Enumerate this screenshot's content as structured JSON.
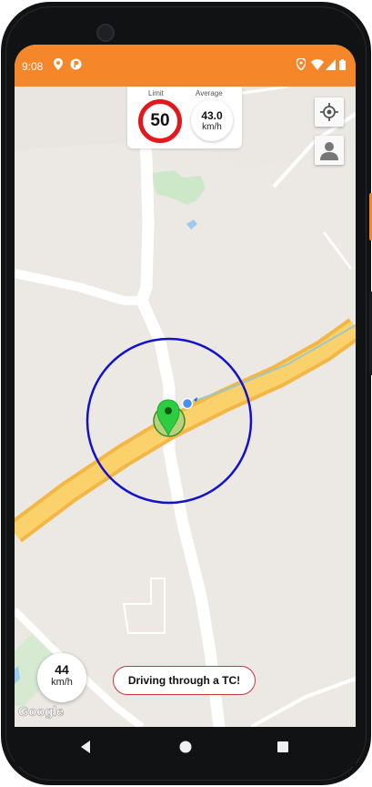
{
  "status_bar": {
    "time": "9:08",
    "background_color": "#f5862a",
    "left_icons": [
      "location-pin-icon",
      "app-p-icon"
    ],
    "right_icons": [
      "location-icon",
      "wifi-icon",
      "signal-icon",
      "battery-icon"
    ]
  },
  "speed_card": {
    "limit_label": "Limit",
    "limit_value": "50",
    "average_label": "Average",
    "average_value": "43.0",
    "average_unit": "km/h",
    "limit_ring_color": "#e3171c"
  },
  "map_controls": {
    "my_location_icon": "crosshair-icon",
    "profile_icon": "person-icon"
  },
  "current_speed": {
    "value": "44",
    "unit": "km/h"
  },
  "alert": {
    "message": "Driving through a TC!",
    "border_color": "#c8363c"
  },
  "map": {
    "attribution": "Google",
    "radius_circle_color": "#1212c8",
    "marker_color": "#2ecc40",
    "road_color": "#f7c65a"
  },
  "nav_bar": {
    "buttons": [
      "back-icon",
      "home-icon",
      "recents-icon"
    ]
  }
}
